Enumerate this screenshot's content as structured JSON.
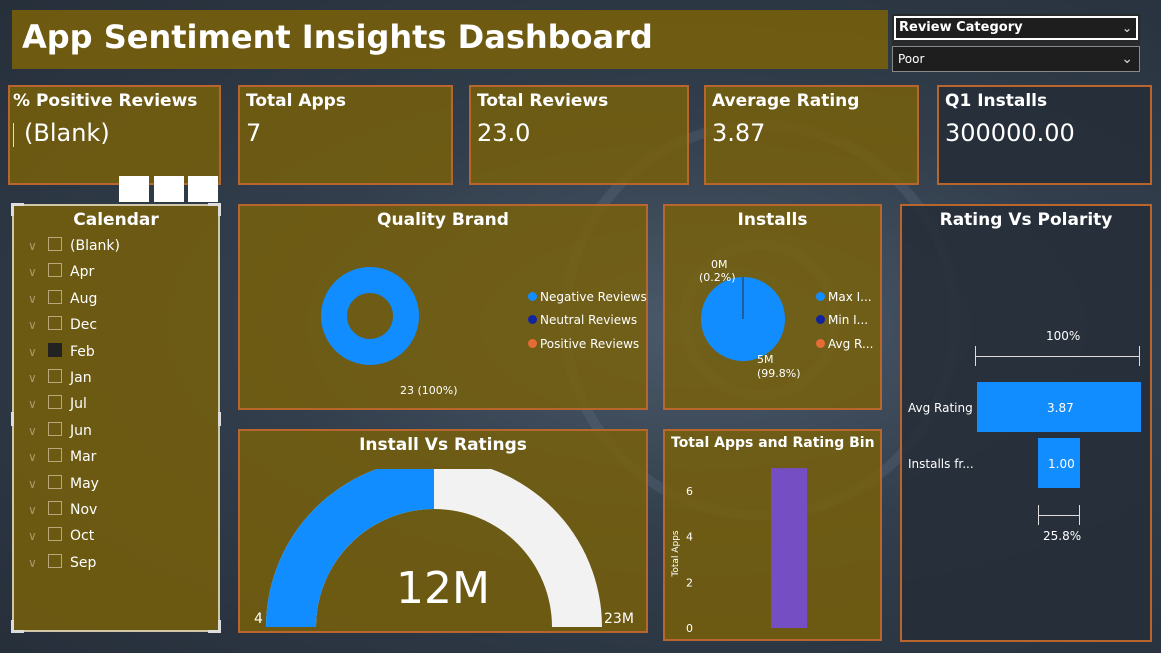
{
  "title": "App Sentiment Insights Dashboard",
  "review_slicer": {
    "label": "Review Category",
    "selected": "Poor"
  },
  "kpis": [
    {
      "label": "% Positive Reviews",
      "value": "(Blank)"
    },
    {
      "label": "Total Apps",
      "value": "7"
    },
    {
      "label": "Total Reviews",
      "value": "23.0"
    },
    {
      "label": "Average Rating",
      "value": "3.87"
    },
    {
      "label": "Q1 Installs",
      "value": "300000.00"
    }
  ],
  "calendar": {
    "title": "Calendar",
    "items": [
      "(Blank)",
      "Apr",
      "Aug",
      "Dec",
      "Feb",
      "Jan",
      "Jul",
      "Jun",
      "Mar",
      "May",
      "Nov",
      "Oct",
      "Sep"
    ],
    "selected": "Feb"
  },
  "quality_brand": {
    "title": "Quality Brand",
    "legend": [
      "Negative Reviews",
      "Neutral Reviews",
      "Positive Reviews"
    ],
    "colors": [
      "#118dff",
      "#12239e",
      "#e66c37"
    ],
    "data_label": "23 (100%)"
  },
  "installs": {
    "title": "Installs",
    "legend": [
      "Max I...",
      "Min I...",
      "Avg R..."
    ],
    "colors": [
      "#118dff",
      "#12239e",
      "#e66c37"
    ],
    "label_small_value": "0M",
    "label_small_pct": "(0.2%)",
    "label_big_value": "5M",
    "label_big_pct": "(99.8%)"
  },
  "rating_vs_polarity": {
    "title": "Rating Vs Polarity",
    "top_label": "100%",
    "bars": [
      {
        "label": "Avg Rating",
        "value": "3.87"
      },
      {
        "label": "Installs fr...",
        "value": "1.00"
      }
    ],
    "bottom_label": "25.8%"
  },
  "install_vs_ratings": {
    "title": "Install Vs Ratings",
    "value": "12M",
    "min": "4",
    "max": "23M",
    "fraction": 0.5
  },
  "chart_data": {
    "type": "bar",
    "title": "Total Apps and Rating Bin",
    "ylabel": "Total Apps",
    "xlabel": "",
    "categories": [
      ""
    ],
    "values": [
      7
    ],
    "yticks": [
      "0",
      "2",
      "4",
      "6"
    ],
    "ylim": [
      0,
      7.4
    ],
    "color": "#744ec2"
  }
}
